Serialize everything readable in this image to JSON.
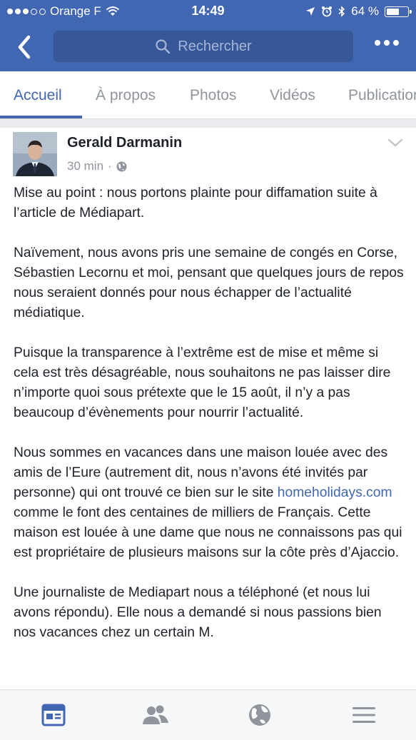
{
  "status_bar": {
    "carrier": "Orange F",
    "time": "14:49",
    "battery_text": "64 %",
    "battery_level": 0.64
  },
  "nav": {
    "search_placeholder": "Rechercher",
    "icons": [
      "back-chevron-icon",
      "search-icon",
      "more-icon"
    ]
  },
  "tabs": [
    {
      "label": "Accueil",
      "active": true
    },
    {
      "label": "À propos",
      "active": false
    },
    {
      "label": "Photos",
      "active": false
    },
    {
      "label": "Vidéos",
      "active": false
    },
    {
      "label": "Publications",
      "active": false
    }
  ],
  "post": {
    "author": "Gerald Darmanin",
    "time": "30 min",
    "separator": "·",
    "privacy_icon": "globe-icon",
    "paragraphs": [
      "Mise au point : nous portons plainte pour diffamation suite à l’article de Médiapart.",
      "Naïvement, nous avons pris une semaine de congés en Corse, Sébastien Lecornu et moi, pensant que quelques jours de repos nous seraient donnés pour nous échapper de l’actualité médiatique.",
      "Puisque la transparence à l’extrême est de mise et même si cela est très désagréable, nous souhaitons ne pas laisser dire n’importe quoi sous prétexte que le 15 août, il n’y a pas beaucoup d’évènements pour nourrir l’actualité.",
      "Une journaliste de Mediapart nous a téléphoné (et nous lui avons répondu). Elle nous a demandé si nous passions bien nos vacances chez un certain M."
    ],
    "p4_before": "Nous sommes en vacances dans une maison louée avec des amis de l’Eure (autrement dit, nous n’avons été invités par personne) qui ont trouvé ce bien sur le site ",
    "p4_link": "homeholidays.com",
    "p4_after": " comme le font des centaines de milliers de Français. Cette maison est louée à une dame que nous ne connaissons pas qui est propriétaire de plusieurs maisons sur la côte près d’Ajaccio."
  },
  "bottom_bar": [
    "news-feed-icon",
    "friends-icon",
    "globe-icon",
    "menu-icon"
  ],
  "colors": {
    "brand": "#4267b2",
    "search_bg": "#365899",
    "muted": "#90949c",
    "text": "#1d2129"
  }
}
